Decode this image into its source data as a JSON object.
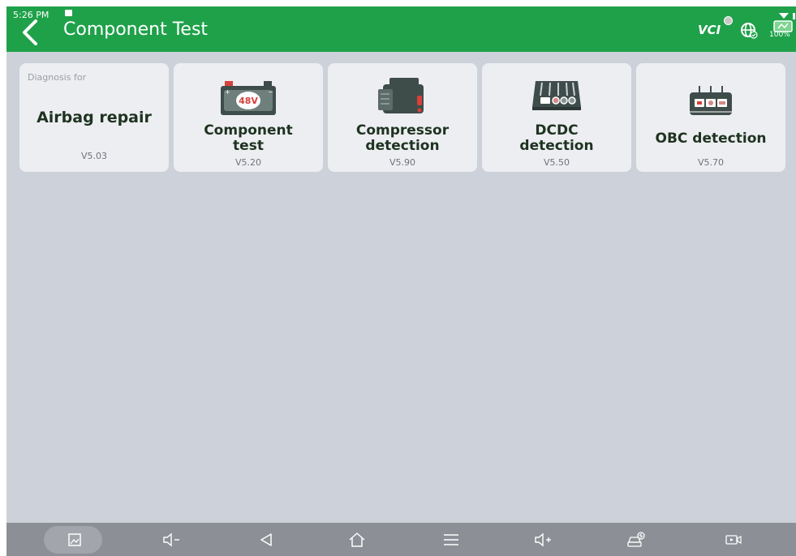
{
  "status_bar": {
    "time": "5:26 PM",
    "battery_percent": "100%"
  },
  "header": {
    "title": "Component Test",
    "vci_label": "VCI"
  },
  "cards": [
    {
      "caption": "Diagnosis for",
      "name": "Airbag repair",
      "version": "V5.03"
    },
    {
      "name_line1": "Component",
      "name_line2": "test",
      "version": "V5.20",
      "icon": "battery-48v-icon",
      "icon_text": "48V"
    },
    {
      "name_line1": "Compressor",
      "name_line2": "detection",
      "version": "V5.90",
      "icon": "compressor-icon"
    },
    {
      "name_line1": "DCDC",
      "name_line2": "detection",
      "version": "V5.50",
      "icon": "dcdc-converter-icon"
    },
    {
      "name": "OBC detection",
      "version": "V5.70",
      "icon": "obc-charger-icon"
    }
  ],
  "nav": {
    "buttons": [
      "screenshot-icon",
      "volume-down-icon",
      "back-icon",
      "home-icon",
      "menu-icon",
      "volume-up-icon",
      "car-diagnostics-icon",
      "screen-record-icon"
    ]
  },
  "colors": {
    "header": "#1fa14a",
    "background": "#cdd1d9",
    "card": "#edeef2",
    "navbar": "#8c8f95"
  }
}
